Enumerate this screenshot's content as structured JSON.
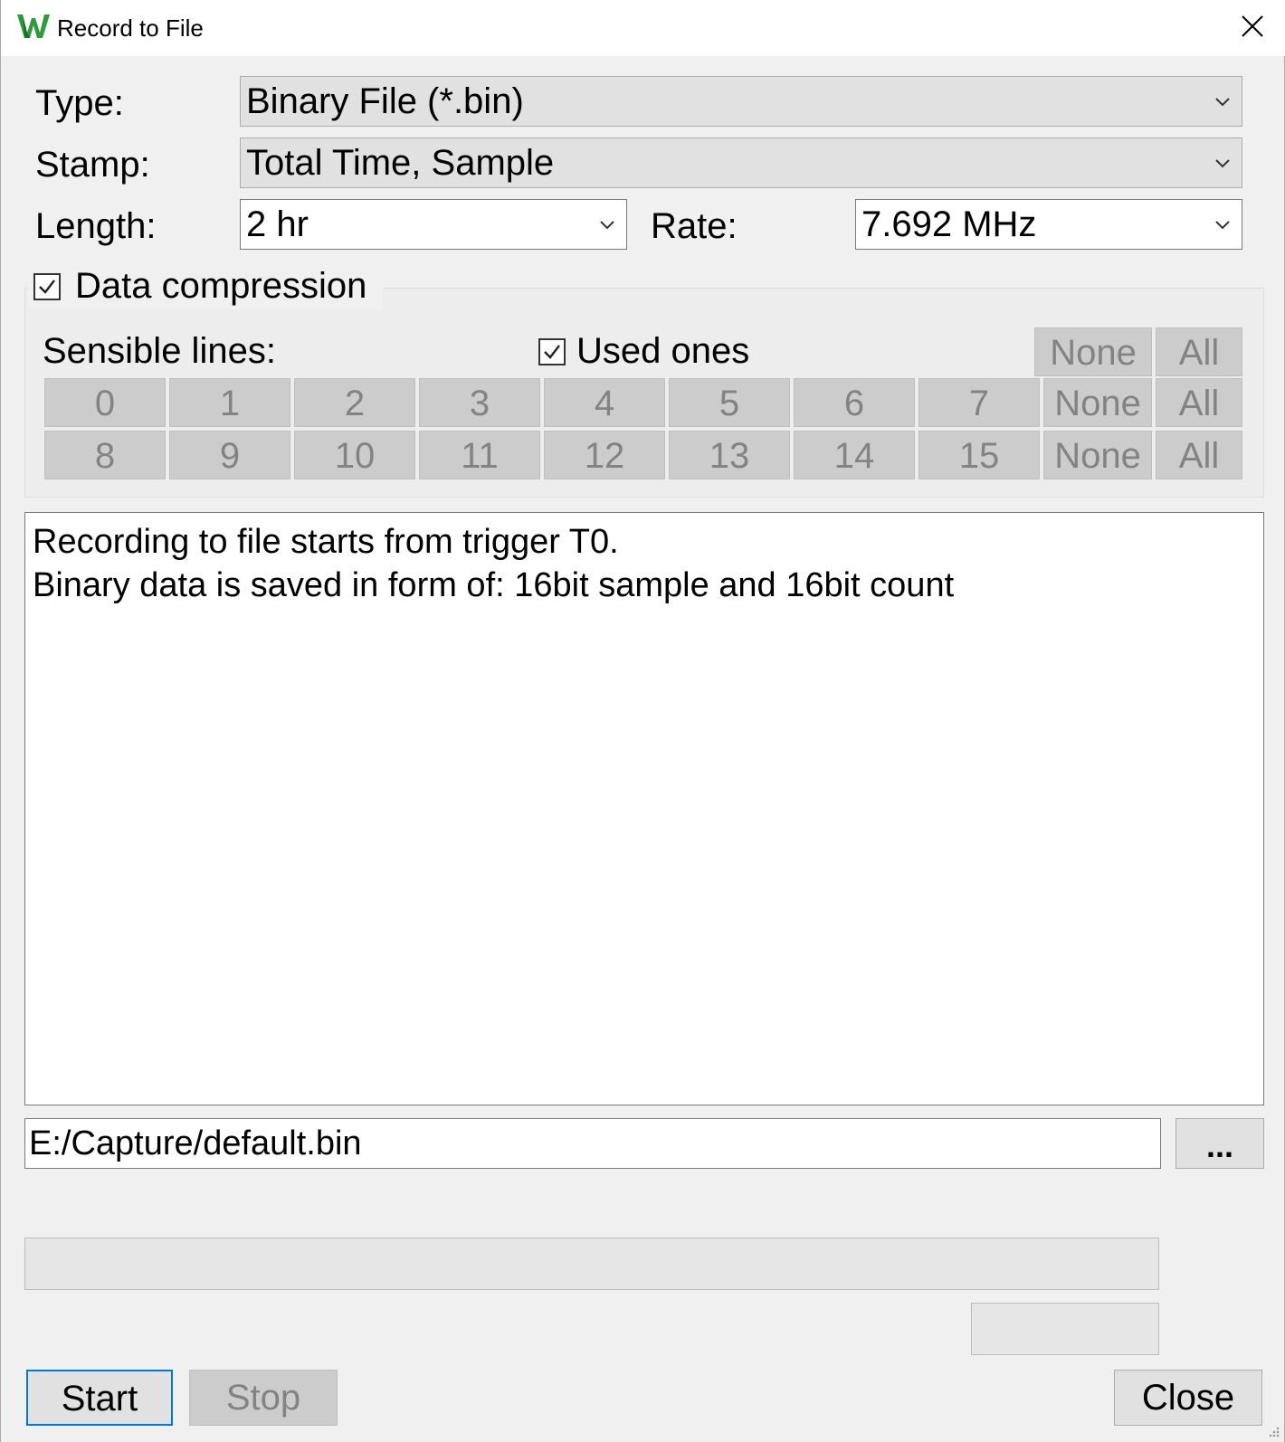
{
  "window": {
    "title": "Record to File",
    "close_glyph": "×"
  },
  "form": {
    "type_label": "Type:",
    "type_value": "Binary File (*.bin)",
    "stamp_label": "Stamp:",
    "stamp_value": "Total Time, Sample",
    "length_label": "Length:",
    "length_value": "2 hr",
    "rate_label": "Rate:",
    "rate_value": "7.692 MHz"
  },
  "compression": {
    "label": "Data compression",
    "checked": true,
    "sensible_label": "Sensible lines:",
    "used_ones_label": "Used ones",
    "used_ones_checked": true,
    "none_label": "None",
    "all_label": "All",
    "row1": [
      "0",
      "1",
      "2",
      "3",
      "4",
      "5",
      "6",
      "7"
    ],
    "row2": [
      "8",
      "9",
      "10",
      "11",
      "12",
      "13",
      "14",
      "15"
    ]
  },
  "info": {
    "line1": "Recording to file starts from trigger T0.",
    "line2": "Binary data is saved in form of: 16bit sample and 16bit count"
  },
  "file": {
    "path": "E:/Capture/default.bin",
    "browse_label": "..."
  },
  "progress": {
    "fraction": 0
  },
  "buttons": {
    "start": "Start",
    "stop": "Stop",
    "close": "Close"
  },
  "icons": {
    "app": "w-logo-icon",
    "close": "close-icon",
    "dropdown": "chevron-down-icon",
    "check": "checkmark-icon"
  },
  "colors": {
    "accent": "#0078d7",
    "logo_green": "#2e9a3a",
    "disabled_text": "#838383"
  }
}
